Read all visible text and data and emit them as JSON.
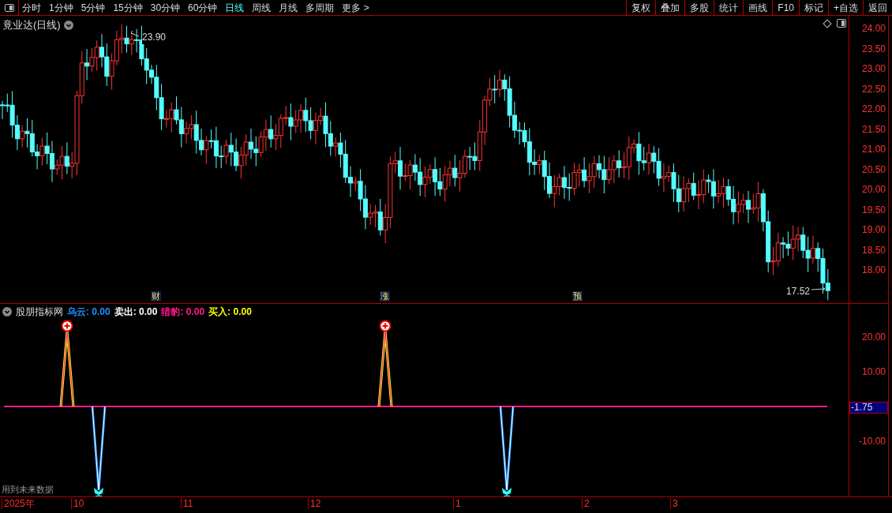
{
  "toolbar": {
    "periods": [
      {
        "label": "分时",
        "selected": false
      },
      {
        "label": "1分钟",
        "selected": false
      },
      {
        "label": "5分钟",
        "selected": false
      },
      {
        "label": "15分钟",
        "selected": false
      },
      {
        "label": "30分钟",
        "selected": false
      },
      {
        "label": "60分钟",
        "selected": false
      },
      {
        "label": "日线",
        "selected": true
      },
      {
        "label": "周线",
        "selected": false
      },
      {
        "label": "月线",
        "selected": false
      },
      {
        "label": "多周期",
        "selected": false
      },
      {
        "label": "更多 >",
        "selected": false
      }
    ],
    "buttons": [
      "复权",
      "叠加",
      "多股",
      "统计",
      "画线",
      "F10",
      "标记",
      "+自选",
      "返回"
    ]
  },
  "main_chart": {
    "title": "竟业达(日线)",
    "high_label": "23.90",
    "low_label": "17.52",
    "markers": [
      "财",
      "涨",
      "预"
    ],
    "axis": [
      "24.00",
      "23.50",
      "23.00",
      "22.50",
      "22.00",
      "21.50",
      "21.00",
      "20.50",
      "20.00",
      "19.50",
      "19.00",
      "18.50",
      "18.00"
    ]
  },
  "indicator": {
    "name": "股朋指标网",
    "legend": [
      {
        "label": "乌云:",
        "value": "0.00",
        "color": "#1e90ff"
      },
      {
        "label": "卖出:",
        "value": "0.00",
        "color": "#ffffff"
      },
      {
        "label": "猎豹:",
        "value": "0.00",
        "color": "#ff1a8c"
      },
      {
        "label": "买入:",
        "value": "0.00",
        "color": "#ffff00"
      }
    ],
    "axis": [
      {
        "label": "20.00",
        "highlight": false
      },
      {
        "label": "10.00",
        "highlight": false
      },
      {
        "label": "-1.75",
        "highlight": true
      },
      {
        "label": "-10.00",
        "highlight": false
      }
    ],
    "note": "用到未来数据"
  },
  "date_axis": [
    "2025年",
    "10",
    "11",
    "12",
    "1",
    "2",
    "3"
  ]
}
